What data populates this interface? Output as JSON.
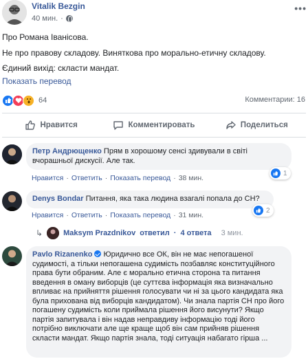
{
  "post": {
    "author": "Vitalik Bezgin",
    "time": "40 мин.",
    "dot": "·",
    "more": "•••",
    "lines": [
      "Про Романа Іванісова.",
      "Не про правову складову. Виняткова про морально-етичну складову.",
      "Єдиний вихід: скласти мандат."
    ],
    "translate_label": "Показать перевод",
    "reactions_count": "64",
    "comments_label": "Комментарии: 16"
  },
  "actions": {
    "like": "Нравится",
    "comment": "Комментировать",
    "share": "Поделиться"
  },
  "comments": [
    {
      "author": "Петр Андрющенко",
      "text": "Прям в хорошому сенсі здивували в світі вчорашньої дискусії. Але так.",
      "like": "Нравится",
      "reply": "Ответить",
      "translate": "Показать перевод",
      "time": "38 мин.",
      "reactions": "1"
    },
    {
      "author": "Denys Bondar",
      "text": "Питання, яка така людина взагалі попала до СН?",
      "like": "Нравится",
      "reply": "Ответить",
      "translate": "Показать перевод",
      "time": "31 мин.",
      "reactions": "2"
    },
    {
      "author": "Pavlo Rizanenko",
      "text": "Юридично все ОК, він не має непогашеної судимості, а тільки непогашена судимість позбавляє конституційного права бути обраним. Але є морально етична сторона та питання введення в оману виборців (це суттєва інформація яка визначально впливає на прийняття рішення голосувати чи ні за цього кандидата яка була прихована від виборців кандидатом). Чи знала партія СН про його погашену судимість коли приймала рішення його висунути? Якщо партія запитувала і він надав неправдиву інформацію тоді його потрібно виключати але ще краще щоб він сам прийняв рішення скласти мандат. Якщо партія знала, тоді ситуація набагато гірша ..."
    }
  ],
  "reply_summary": {
    "author": "Maksym Prazdnikov",
    "answered": "ответил",
    "count": "4 ответа",
    "time": "3 мин."
  },
  "colors": {
    "link": "#385898",
    "like_blue": "#1877f2",
    "love_red": "#f33e58",
    "wow_yellow": "#f7b125",
    "bubble_bg": "#f2f3f5"
  }
}
